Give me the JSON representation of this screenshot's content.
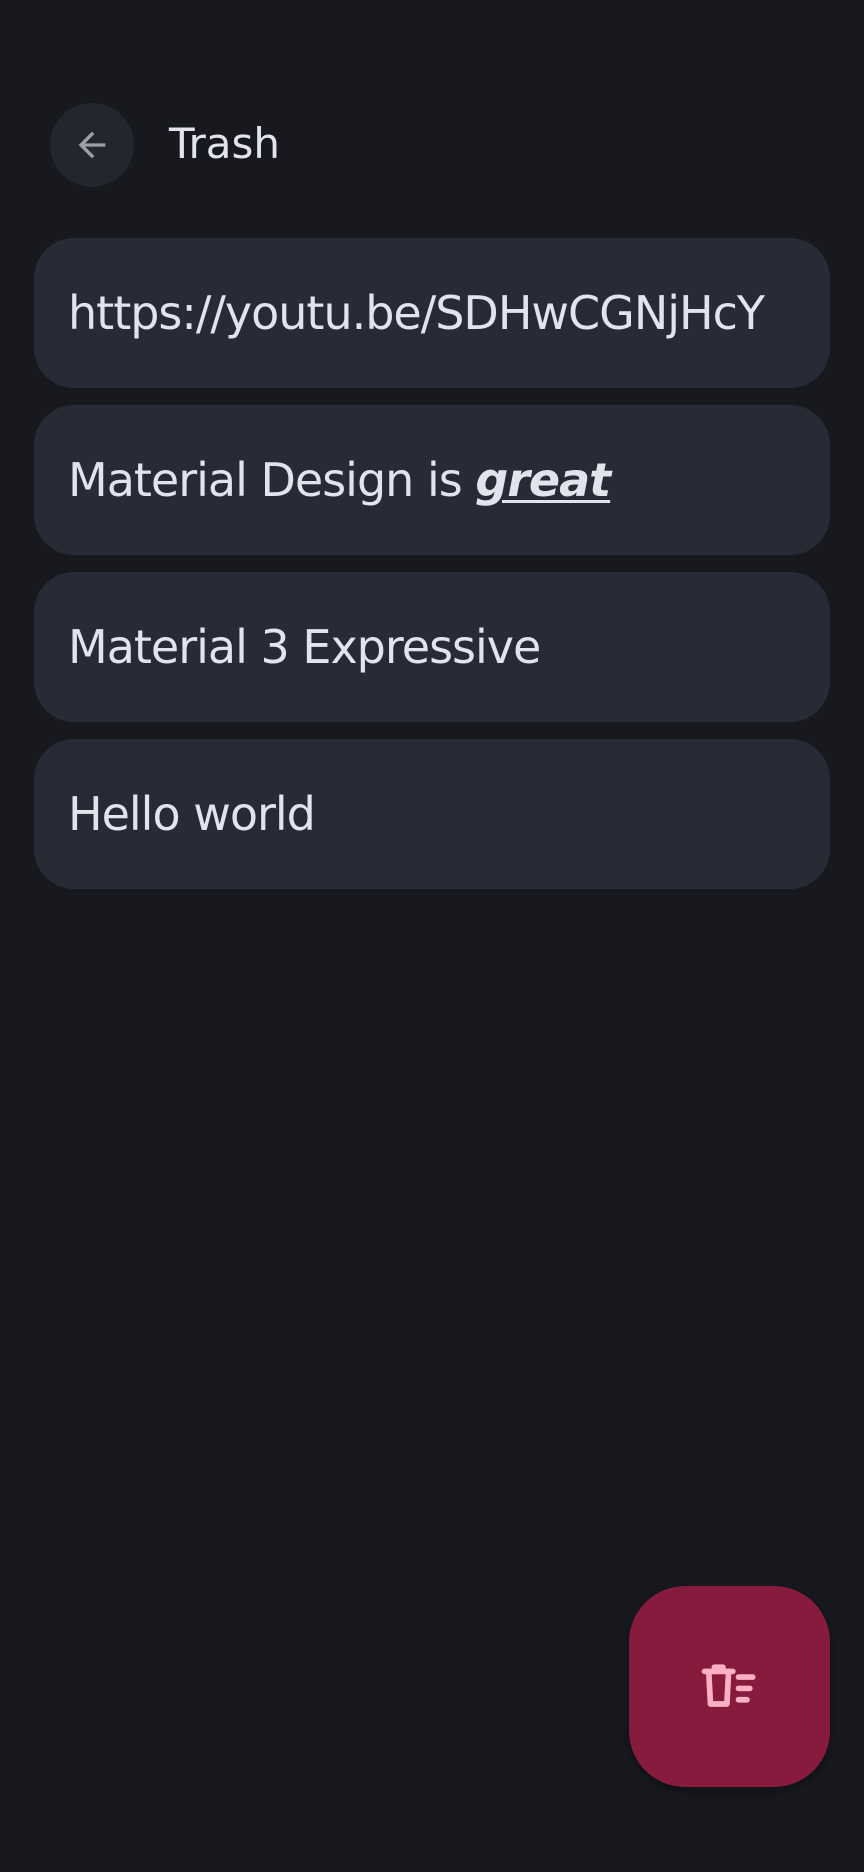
{
  "header": {
    "title": "Trash",
    "back_icon": "arrow-back-icon"
  },
  "notes": [
    {
      "text": "https://youtu.be/SDHwCGNjHcY"
    },
    {
      "text": "Material Design is ",
      "emphasis": "great"
    },
    {
      "text": "Material 3 Expressive"
    },
    {
      "text": "Hello world"
    }
  ],
  "fab": {
    "icon": "delete-sweep-icon"
  },
  "colors": {
    "background": "#17191e",
    "card": "#282b35",
    "text": "#e2e3ec",
    "fab": "#861b3d",
    "fab_icon": "#ffb1c3"
  }
}
